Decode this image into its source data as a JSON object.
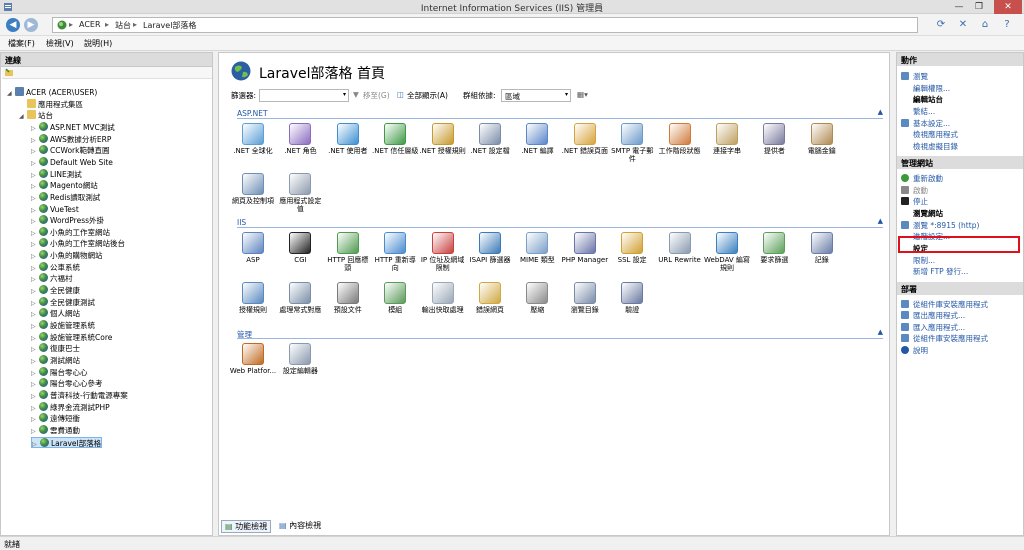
{
  "window": {
    "title": "Internet Information Services (IIS) 管理員",
    "minimize": "—",
    "maximize": "❐",
    "close": "✕"
  },
  "address": {
    "crumbs": [
      "ACER",
      "站台",
      "Laravel部落格"
    ],
    "separator": "▸"
  },
  "menu": [
    "檔案(F)",
    "檢視(V)",
    "說明(H)"
  ],
  "connections": {
    "header": "連線",
    "tree": [
      {
        "label": "ACER (ACER\\USER)",
        "indent": 0,
        "icon": "server",
        "exp": "◢"
      },
      {
        "label": "應用程式集區",
        "indent": 1,
        "icon": "folder",
        "exp": ""
      },
      {
        "label": "站台",
        "indent": 1,
        "icon": "folder",
        "exp": "◢"
      },
      {
        "label": "ASP.NET MVC測試",
        "indent": 2,
        "icon": "globe",
        "exp": "▷"
      },
      {
        "label": "AWS數據分析ERP",
        "indent": 2,
        "icon": "globe",
        "exp": "▷"
      },
      {
        "label": "CCWork範轉直圓",
        "indent": 2,
        "icon": "globe",
        "exp": "▷"
      },
      {
        "label": "Default Web Site",
        "indent": 2,
        "icon": "globe",
        "exp": "▷"
      },
      {
        "label": "LINE測試",
        "indent": 2,
        "icon": "globe",
        "exp": "▷"
      },
      {
        "label": "Magento網站",
        "indent": 2,
        "icon": "globe",
        "exp": "▷"
      },
      {
        "label": "Redis讀取測試",
        "indent": 2,
        "icon": "globe",
        "exp": "▷"
      },
      {
        "label": "VueTest",
        "indent": 2,
        "icon": "globe",
        "exp": "▷"
      },
      {
        "label": "WordPress外掛",
        "indent": 2,
        "icon": "globe",
        "exp": "▷"
      },
      {
        "label": "小魚的工作室網站",
        "indent": 2,
        "icon": "globe",
        "exp": "▷"
      },
      {
        "label": "小魚的工作室網站後台",
        "indent": 2,
        "icon": "globe",
        "exp": "▷"
      },
      {
        "label": "小魚的購物網站",
        "indent": 2,
        "icon": "globe",
        "exp": "▷"
      },
      {
        "label": "公車系統",
        "indent": 2,
        "icon": "globe",
        "exp": "▷"
      },
      {
        "label": "六福村",
        "indent": 2,
        "icon": "globe",
        "exp": "▷"
      },
      {
        "label": "全民健康",
        "indent": 2,
        "icon": "globe",
        "exp": "▷"
      },
      {
        "label": "全民健康測試",
        "indent": 2,
        "icon": "globe",
        "exp": "▷"
      },
      {
        "label": "個人網站",
        "indent": 2,
        "icon": "globe",
        "exp": "▷"
      },
      {
        "label": "設施管理系統",
        "indent": 2,
        "icon": "globe",
        "exp": "▷"
      },
      {
        "label": "設施管理系統Core",
        "indent": 2,
        "icon": "globe",
        "exp": "▷"
      },
      {
        "label": "復康巴士",
        "indent": 2,
        "icon": "globe",
        "exp": "▷"
      },
      {
        "label": "測試網站",
        "indent": 2,
        "icon": "globe",
        "exp": "▷"
      },
      {
        "label": "陽台零心心",
        "indent": 2,
        "icon": "globe",
        "exp": "▷"
      },
      {
        "label": "陽台零心心參考",
        "indent": 2,
        "icon": "globe",
        "exp": "▷"
      },
      {
        "label": "普濟科技-行動電源專案",
        "indent": 2,
        "icon": "globe",
        "exp": "▷"
      },
      {
        "label": "綠界金流測試PHP",
        "indent": 2,
        "icon": "globe",
        "exp": "▷"
      },
      {
        "label": "遠傳短衝",
        "indent": 2,
        "icon": "globe",
        "exp": "▷"
      },
      {
        "label": "雲費通動",
        "indent": 2,
        "icon": "globe",
        "exp": "▷"
      },
      {
        "label": "Laravel部落格",
        "indent": 2,
        "icon": "globe",
        "exp": "▷",
        "selected": true
      }
    ]
  },
  "main": {
    "title": "Laravel部落格 首頁",
    "filter_label": "篩選器:",
    "go_label": "移至(G)",
    "show_all_label": "全部顯示(A)",
    "group_by_label": "群組依據:",
    "group_by_value": "區域",
    "sections": [
      {
        "title": "ASP.NET",
        "features": [
          {
            "label": ".NET 全球化",
            "icon": "globe-doc-icon",
            "color": "#5a9fd6"
          },
          {
            "label": ".NET 角色",
            "icon": "roles-icon",
            "color": "#8a6bbf"
          },
          {
            "label": ".NET 使用者",
            "icon": "users-icon",
            "color": "#3d8fd1"
          },
          {
            "label": ".NET 信任層級",
            "icon": "trust-icon",
            "color": "#3e9a45"
          },
          {
            "label": ".NET 授權規則",
            "icon": "auth-icon",
            "color": "#c79a2b"
          },
          {
            "label": ".NET 設定檔",
            "icon": "profile-icon",
            "color": "#7a8da8"
          },
          {
            "label": ".NET 編譯",
            "icon": "compile-icon",
            "color": "#5b86c9"
          },
          {
            "label": ".NET 錯誤頁面",
            "icon": "error-page-icon",
            "color": "#d6a43a"
          },
          {
            "label": "SMTP 電子郵件",
            "icon": "mail-icon",
            "color": "#6c9ac9"
          },
          {
            "label": "工作階段狀態",
            "icon": "session-icon",
            "color": "#d07b3a"
          },
          {
            "label": "連接字串",
            "icon": "connection-icon",
            "color": "#c0a060"
          },
          {
            "label": "提供者",
            "icon": "provider-icon",
            "color": "#7a7a9e"
          },
          {
            "label": "電腦金鑰",
            "icon": "machine-key-icon",
            "color": "#b08a50"
          },
          {
            "label": "網頁及控制項",
            "icon": "pages-icon",
            "color": "#6f8fb5"
          },
          {
            "label": "應用程式設定值",
            "icon": "app-settings-icon",
            "color": "#8c9aad"
          }
        ]
      },
      {
        "title": "IIS",
        "features": [
          {
            "label": "ASP",
            "icon": "asp-icon",
            "color": "#5e84c0"
          },
          {
            "label": "CGI",
            "icon": "cgi-icon",
            "color": "#222222"
          },
          {
            "label": "HTTP 回應標頭",
            "icon": "response-headers-icon",
            "color": "#4e9a4e"
          },
          {
            "label": "HTTP 重新導向",
            "icon": "redirect-icon",
            "color": "#4a8ad0"
          },
          {
            "label": "IP 位址及網域限制",
            "icon": "ip-restrict-icon",
            "color": "#c84040"
          },
          {
            "label": "ISAPI 篩選器",
            "icon": "isapi-icon",
            "color": "#3a7ab8"
          },
          {
            "label": "MIME 類型",
            "icon": "mime-icon",
            "color": "#7aa0c8"
          },
          {
            "label": "PHP Manager",
            "icon": "php-icon",
            "color": "#6a74a8"
          },
          {
            "label": "SSL 設定",
            "icon": "lock-icon",
            "color": "#d0a030"
          },
          {
            "label": "URL Rewrite",
            "icon": "rewrite-icon",
            "color": "#8a9ab0"
          },
          {
            "label": "WebDAV 編寫規則",
            "icon": "webdav-icon",
            "color": "#3a80c0"
          },
          {
            "label": "要求篩選",
            "icon": "request-filter-icon",
            "color": "#5aa05a"
          },
          {
            "label": "記錄",
            "icon": "logging-icon",
            "color": "#6a7ea8"
          },
          {
            "label": "授權規則",
            "icon": "authorization-icon",
            "color": "#5a8ac0"
          },
          {
            "label": "處理常式對應",
            "icon": "handler-icon",
            "color": "#7a8ea8"
          },
          {
            "label": "預設文件",
            "icon": "default-doc-icon",
            "color": "#7a7a7a"
          },
          {
            "label": "模組",
            "icon": "modules-icon",
            "color": "#5a9a5a"
          },
          {
            "label": "輸出快取處理",
            "icon": "output-cache-icon",
            "color": "#9aa8b8"
          },
          {
            "label": "錯誤網頁",
            "icon": "error-pages-icon",
            "color": "#d0a840"
          },
          {
            "label": "壓縮",
            "icon": "compression-icon",
            "color": "#8a8a8a"
          },
          {
            "label": "瀏覽目錄",
            "icon": "dir-browse-icon",
            "color": "#7a8ca8"
          },
          {
            "label": "驗證",
            "icon": "authentication-icon",
            "color": "#6a7aa0"
          }
        ]
      },
      {
        "title": "管理",
        "features": [
          {
            "label": "Web Platfor...",
            "icon": "web-platform-icon",
            "color": "#c06a20"
          },
          {
            "label": "設定編輯器",
            "icon": "config-editor-icon",
            "color": "#8a9aae"
          }
        ]
      }
    ],
    "tabs": [
      "功能檢視",
      "內容檢視"
    ]
  },
  "actions": {
    "header": "動作",
    "items": [
      {
        "label": "瀏覽",
        "type": "link",
        "icon": "explore-icon"
      },
      {
        "label": "編輯權限...",
        "type": "link",
        "icon": ""
      },
      {
        "label": "編輯站台",
        "type": "group",
        "icon": ""
      },
      {
        "label": "繫結...",
        "type": "link",
        "icon": ""
      },
      {
        "label": "基本設定...",
        "type": "link",
        "icon": "settings-icon"
      },
      {
        "label": "檢視應用程式",
        "type": "link",
        "icon": ""
      },
      {
        "label": "檢視虛擬目錄",
        "type": "link",
        "icon": ""
      },
      {
        "label": "管理網站",
        "type": "header",
        "icon": ""
      },
      {
        "label": "重新啟動",
        "type": "link",
        "icon": "restart-icon"
      },
      {
        "label": "啟動",
        "type": "disabled",
        "icon": "start-icon"
      },
      {
        "label": "停止",
        "type": "link",
        "icon": "stop-icon"
      },
      {
        "label": "瀏覽網站",
        "type": "group",
        "icon": ""
      },
      {
        "label": "瀏覽 *:8915 (http)",
        "type": "link",
        "icon": "browse-icon"
      },
      {
        "label": "進階設定...",
        "type": "link",
        "icon": ""
      },
      {
        "label": "設定",
        "type": "group",
        "icon": ""
      },
      {
        "label": "限制...",
        "type": "link",
        "icon": ""
      },
      {
        "label": "新增 FTP 發行...",
        "type": "link",
        "icon": ""
      },
      {
        "label": "部署",
        "type": "header",
        "icon": ""
      },
      {
        "label": "從組件庫安裝應用程式",
        "type": "link",
        "icon": "install-icon"
      },
      {
        "label": "匯出應用程式...",
        "type": "link",
        "icon": "export-icon"
      },
      {
        "label": "匯入應用程式...",
        "type": "link",
        "icon": "import-icon"
      },
      {
        "label": "從組件庫安裝應用程式",
        "type": "link",
        "icon": "install-icon"
      },
      {
        "label": "說明",
        "type": "link",
        "icon": "help-icon"
      }
    ]
  },
  "status": "就緒",
  "colors": {
    "link": "#2458a6",
    "highlight": "#e0101a",
    "close": "#c7504d"
  }
}
